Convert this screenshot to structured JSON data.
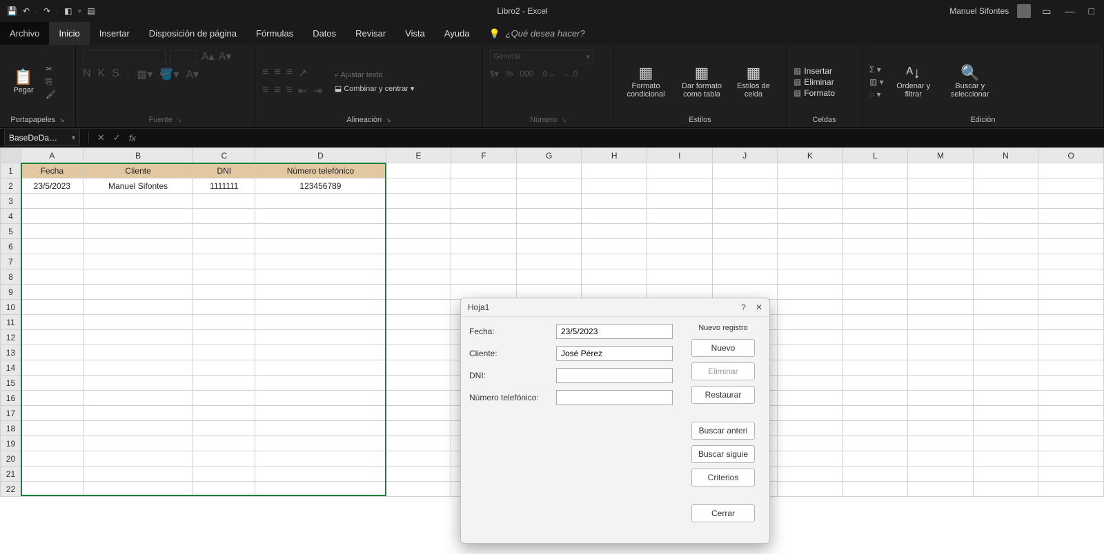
{
  "window": {
    "title": "Libro2 - Excel",
    "username": "Manuel Sifontes"
  },
  "qat": {
    "save": "💾",
    "undo": "↶",
    "redo": "↷"
  },
  "tabs": {
    "archivo": "Archivo",
    "inicio": "Inicio",
    "insertar": "Insertar",
    "disposicion": "Disposición de página",
    "formulas": "Fórmulas",
    "datos": "Datos",
    "revisar": "Revisar",
    "vista": "Vista",
    "ayuda": "Ayuda",
    "tellme_placeholder": "¿Qué desea hacer?"
  },
  "ribbon": {
    "portapapeles": {
      "label": "Portapapeles",
      "pegar": "Pegar"
    },
    "fuente": {
      "label": "Fuente"
    },
    "alineacion": {
      "label": "Alineación",
      "ajustar": "Ajustar texto",
      "combinar": "Combinar y centrar"
    },
    "numero": {
      "label": "Número",
      "format": "General"
    },
    "estilos": {
      "label": "Estilos",
      "fcond": "Formato condicional",
      "ftabla": "Dar formato como tabla",
      "ecelda": "Estilos de celda"
    },
    "celdas": {
      "label": "Celdas",
      "insertar": "Insertar",
      "eliminar": "Eliminar",
      "formato": "Formato"
    },
    "edicion": {
      "label": "Edición",
      "ordenar": "Ordenar y filtrar",
      "buscar": "Buscar y seleccionar"
    }
  },
  "namebox": "BaseDeDa…",
  "columns": [
    "A",
    "B",
    "C",
    "D",
    "E",
    "F",
    "G",
    "H",
    "I",
    "J",
    "K",
    "L",
    "M",
    "N",
    "O"
  ],
  "rows": [
    "1",
    "2",
    "3",
    "4",
    "5",
    "6",
    "7",
    "8",
    "9",
    "10",
    "11",
    "12",
    "13",
    "14",
    "15",
    "16",
    "17",
    "18",
    "19",
    "20",
    "21",
    "22"
  ],
  "sheet": {
    "headers": {
      "A": "Fecha",
      "B": "Cliente",
      "C": "DNI",
      "D": "Número telefónico"
    },
    "row2": {
      "A": "23/5/2023",
      "B": "Manuel Sifontes",
      "C": "1111111",
      "D": "123456789"
    }
  },
  "dialog": {
    "title": "Hoja1",
    "status": "Nuevo registro",
    "fields": {
      "fecha_label": "Fecha:",
      "fecha_value": "23/5/2023",
      "cliente_label": "Cliente:",
      "cliente_value": "José Pérez",
      "dni_label": "DNI:",
      "dni_value": "",
      "tel_label": "Número telefónico:",
      "tel_value": ""
    },
    "buttons": {
      "nuevo": "Nuevo",
      "eliminar": "Eliminar",
      "restaurar": "Restaurar",
      "anterior": "Buscar anteri",
      "siguiente": "Buscar siguie",
      "criterios": "Criterios",
      "cerrar": "Cerrar"
    }
  }
}
